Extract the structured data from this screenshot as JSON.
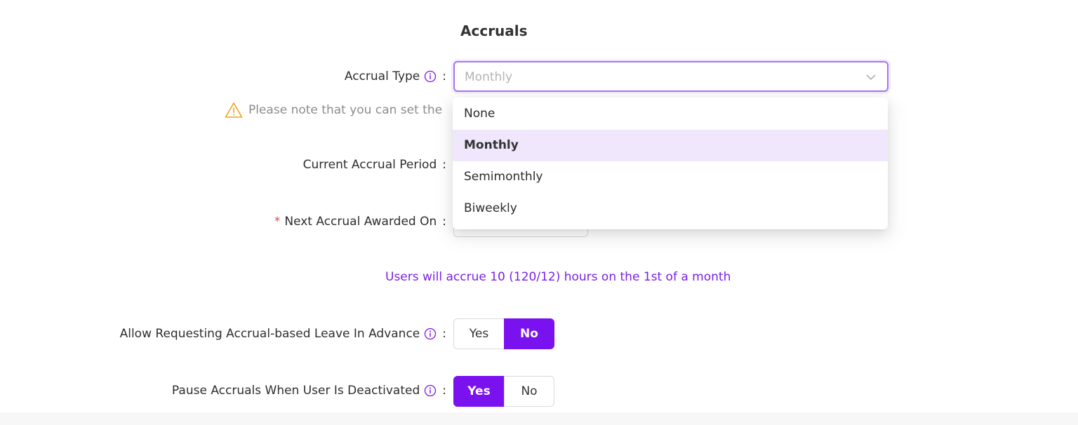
{
  "section": {
    "title": "Accruals"
  },
  "accrual_type": {
    "label": "Accrual Type",
    "selected_value": "Monthly",
    "options": [
      "None",
      "Monthly",
      "Semimonthly",
      "Biweekly"
    ]
  },
  "warning": {
    "text": "Please note that you can set the"
  },
  "current_period": {
    "label": "Current Accrual Period"
  },
  "next_awarded": {
    "label": "Next Accrual Awarded On",
    "required_mark": "*"
  },
  "accrual_note": {
    "text": "Users will accrue 10 (120/12) hours on the 1st of a month"
  },
  "advance_leave": {
    "label": "Allow Requesting Accrual-based Leave In Advance",
    "yes": "Yes",
    "no": "No",
    "selected": "No"
  },
  "pause_accruals": {
    "label": "Pause Accruals When User Is Deactivated",
    "yes": "Yes",
    "no": "No",
    "selected": "Yes"
  },
  "colon": ":",
  "colors": {
    "accent": "#7a12f0",
    "accent_text": "#7a1fe8",
    "highlight": "#f1e7fd",
    "warning": "#f0a020"
  }
}
